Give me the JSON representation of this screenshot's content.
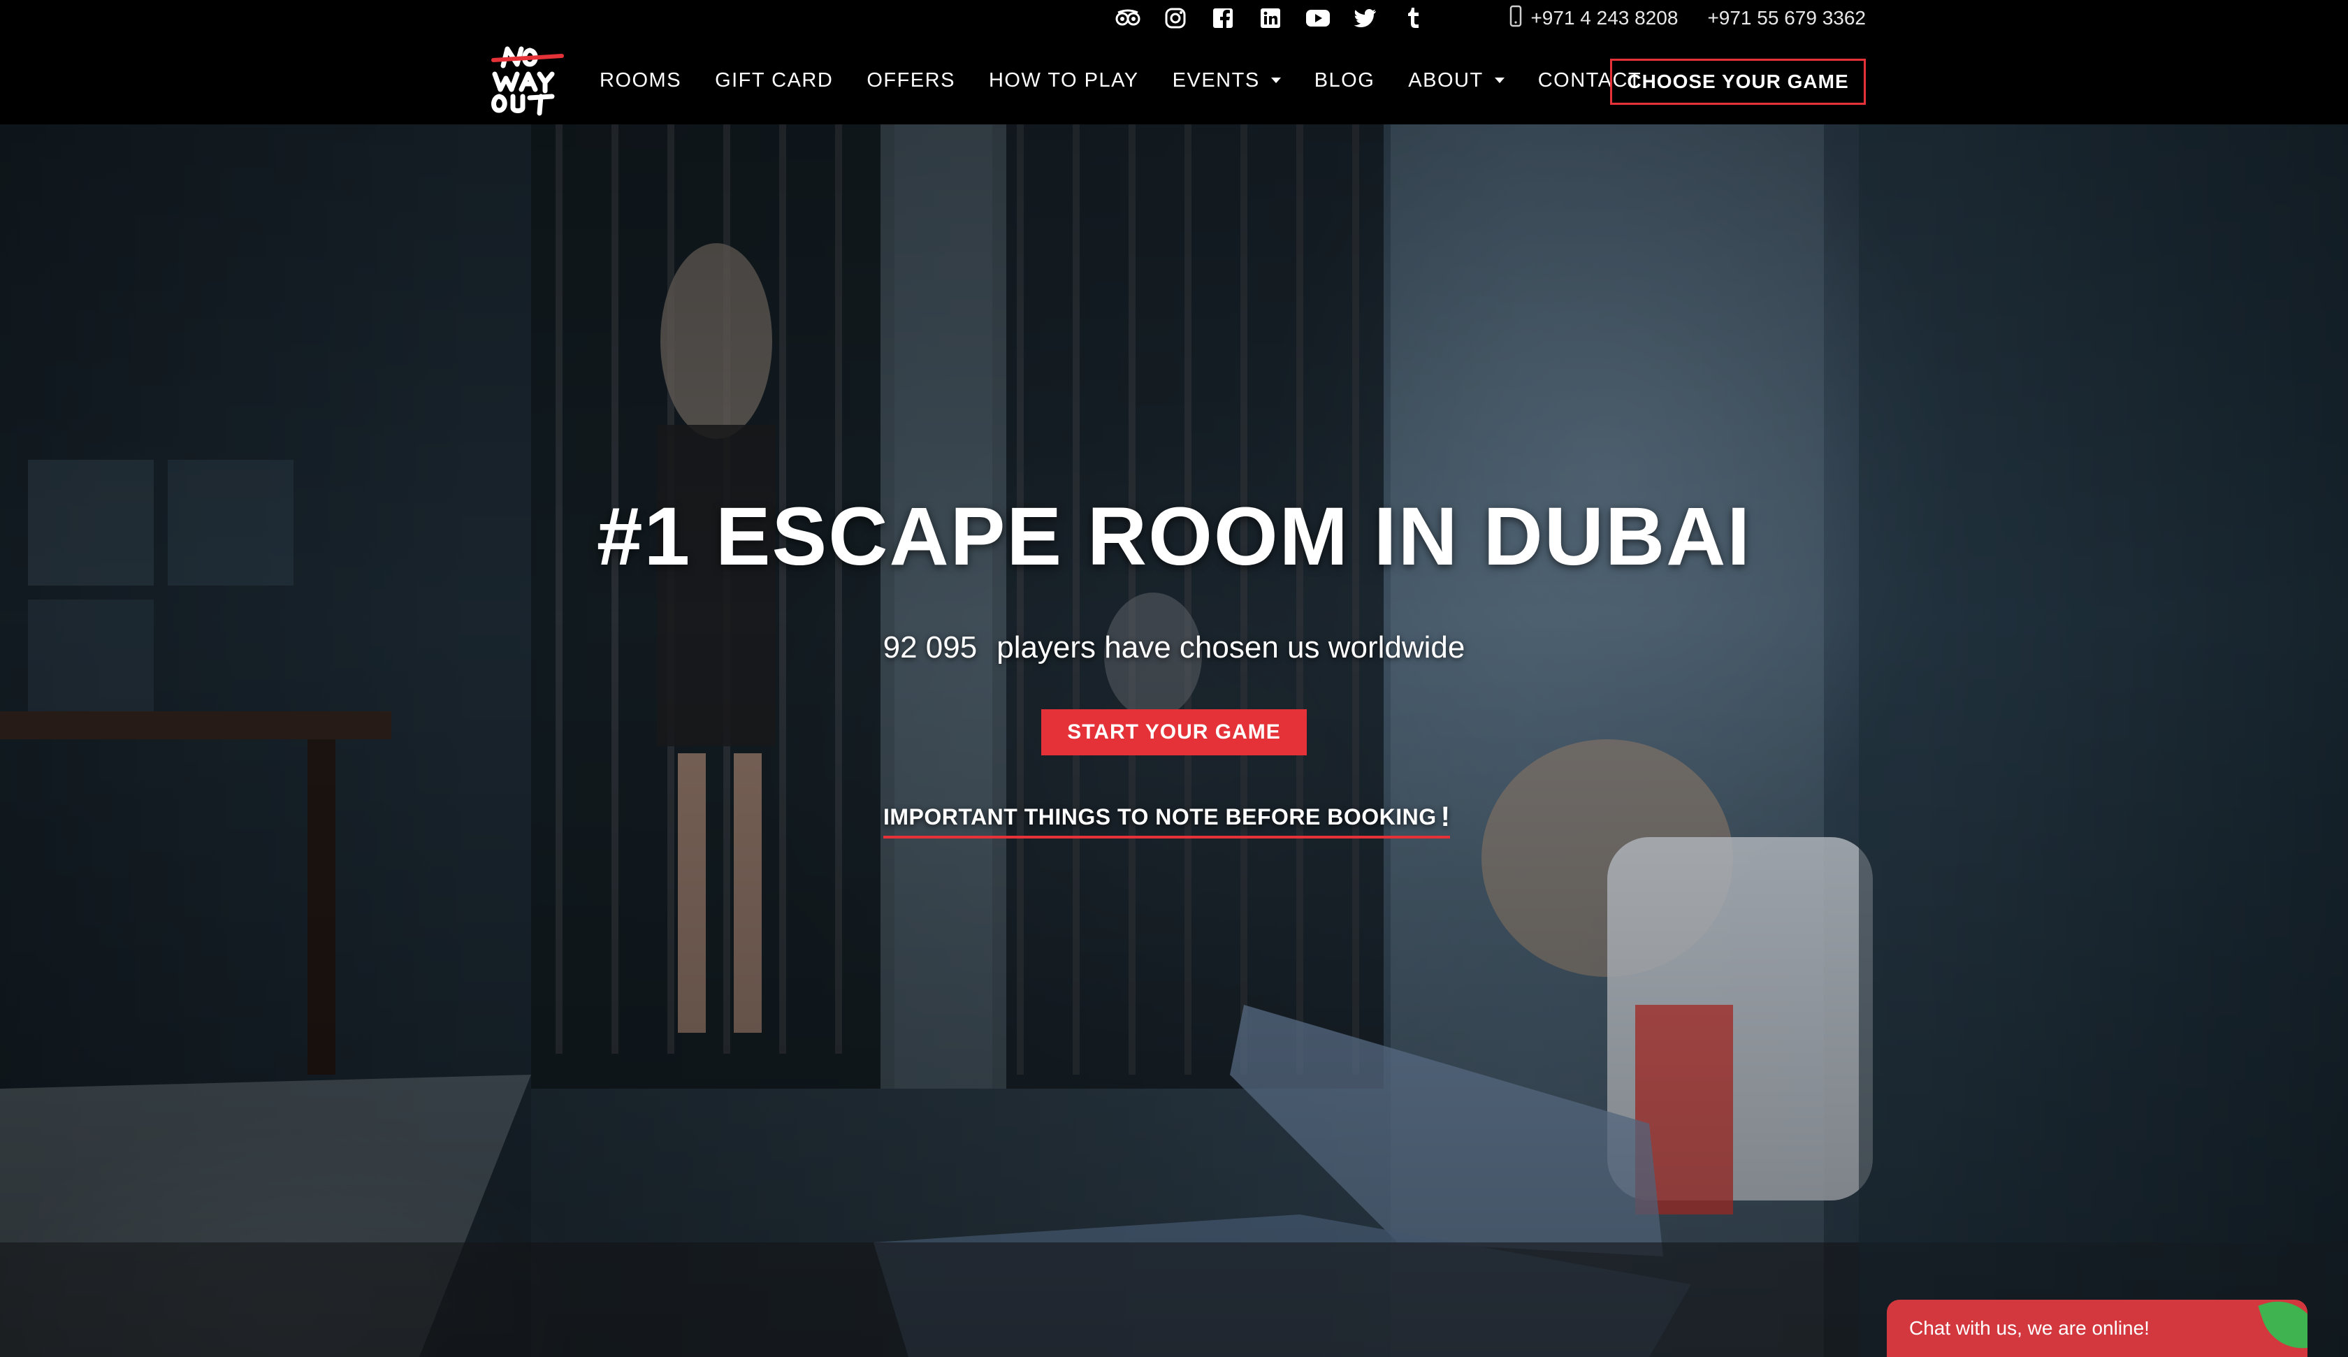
{
  "topbar": {
    "social_icons": [
      "tripadvisor-icon",
      "instagram-icon",
      "facebook-icon",
      "linkedin-icon",
      "youtube-icon",
      "twitter-icon",
      "tumblr-icon"
    ],
    "phone_1": "+971 4 243 8208",
    "phone_2": "+971 55 679 3362"
  },
  "nav": {
    "logo_text": "NO WAY OUT",
    "items": [
      {
        "label": "ROOMS",
        "dropdown": false
      },
      {
        "label": "GIFT CARD",
        "dropdown": false
      },
      {
        "label": "OFFERS",
        "dropdown": false
      },
      {
        "label": "HOW TO PLAY",
        "dropdown": false
      },
      {
        "label": "EVENTS",
        "dropdown": true
      },
      {
        "label": "BLOG",
        "dropdown": false
      },
      {
        "label": "ABOUT",
        "dropdown": true
      },
      {
        "label": "CONTACT",
        "dropdown": false
      }
    ],
    "cta_label": "CHOOSE YOUR GAME"
  },
  "hero": {
    "title": "#1 ESCAPE ROOM IN DUBAI",
    "player_count": "92 095",
    "subtitle_rest": "players have chosen us worldwide",
    "start_button": "START YOUR GAME",
    "note_link": "IMPORTANT THINGS TO NOTE BEFORE BOOKING",
    "note_bang": "!"
  },
  "chat": {
    "label": "Chat with us, we are online!"
  },
  "colors": {
    "accent": "#e53238",
    "chat_bg": "#d3383f",
    "chat_leaf": "#3fb34f"
  }
}
